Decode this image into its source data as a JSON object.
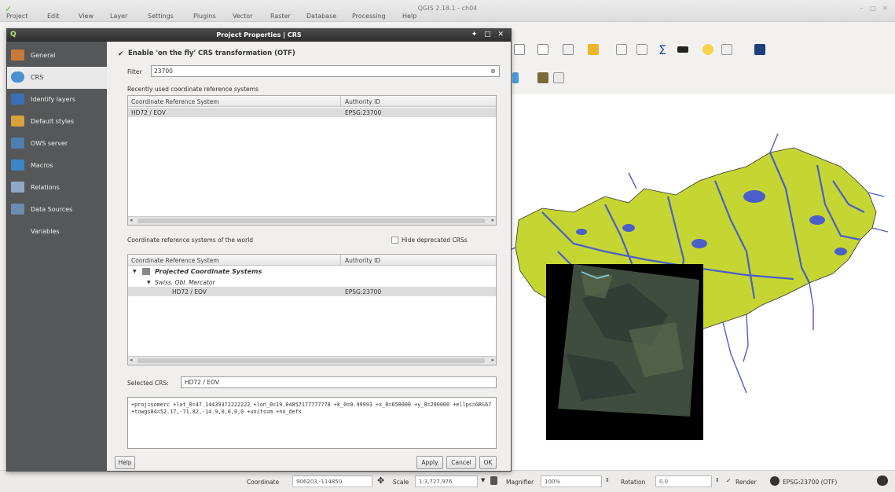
{
  "main_window": {
    "title": "QGIS 2.18.1 - ch04",
    "menus": [
      "Project",
      "Edit",
      "View",
      "Layer",
      "Settings",
      "Plugins",
      "Vector",
      "Raster",
      "Database",
      "Processing",
      "Help"
    ]
  },
  "dialog": {
    "title": "Project Properties | CRS",
    "sidebar": [
      {
        "label": "General",
        "icon": "general-icon",
        "active": false
      },
      {
        "label": "CRS",
        "icon": "globe-icon",
        "active": true
      },
      {
        "label": "Identify layers",
        "icon": "identify-icon",
        "active": false
      },
      {
        "label": "Default styles",
        "icon": "styles-icon",
        "active": false
      },
      {
        "label": "OWS server",
        "icon": "ows-icon",
        "active": false
      },
      {
        "label": "Macros",
        "icon": "macros-icon",
        "active": false
      },
      {
        "label": "Relations",
        "icon": "relations-icon",
        "active": false
      },
      {
        "label": "Data Sources",
        "icon": "data-sources-icon",
        "active": false
      },
      {
        "label": "Variables",
        "icon": "variables-icon",
        "active": false
      }
    ],
    "otf_label": "Enable 'on the fly' CRS transformation (OTF)",
    "otf_checked": true,
    "filter_label": "Filter",
    "filter_value": "23700",
    "recent_label": "Recently used coordinate reference systems",
    "recent_table": {
      "columns": [
        "Coordinate Reference System",
        "Authority ID"
      ],
      "rows": [
        {
          "crs": "HD72 / EOV",
          "auth": "EPSG:23700"
        }
      ]
    },
    "world_label": "Coordinate reference systems of the world",
    "hide_deprecated_label": "Hide deprecated CRSs",
    "world_table": {
      "columns": [
        "Coordinate Reference System",
        "Authority ID"
      ],
      "group": "Projected Coordinate Systems",
      "subgroup": "Swiss. Obl. Mercator",
      "row": {
        "crs": "HD72 / EOV",
        "auth": "EPSG:23700"
      }
    },
    "selected_crs_label": "Selected CRS:",
    "selected_crs_value": "HD72 / EOV",
    "proj_string": "+proj=somerc +lat_0=47.14439372222222 +lon_0=19.04857177777778 +k_0=0.99993 +x_0=650000 +y_0=200000 +ellps=GRS67 +towgs84=52.17,-71.82,-14.9,0,0,0,0 +units=m +no_defs",
    "buttons": {
      "help": "Help",
      "apply": "Apply",
      "cancel": "Cancel",
      "ok": "OK"
    }
  },
  "statusbar": {
    "coordinate_label": "Coordinate",
    "coordinate_value": "906203,-114850",
    "scale_label": "Scale",
    "scale_value": "1:3,727,976",
    "magnifier_label": "Magnifier",
    "magnifier_value": "100%",
    "rotation_label": "Rotation",
    "rotation_value": "0.0",
    "render_label": "Render",
    "crs_label": "EPSG:23700 (OTF)"
  },
  "colors": {
    "land": "#c5d532",
    "water": "#4a5fc9",
    "sidebar": "#555758"
  }
}
